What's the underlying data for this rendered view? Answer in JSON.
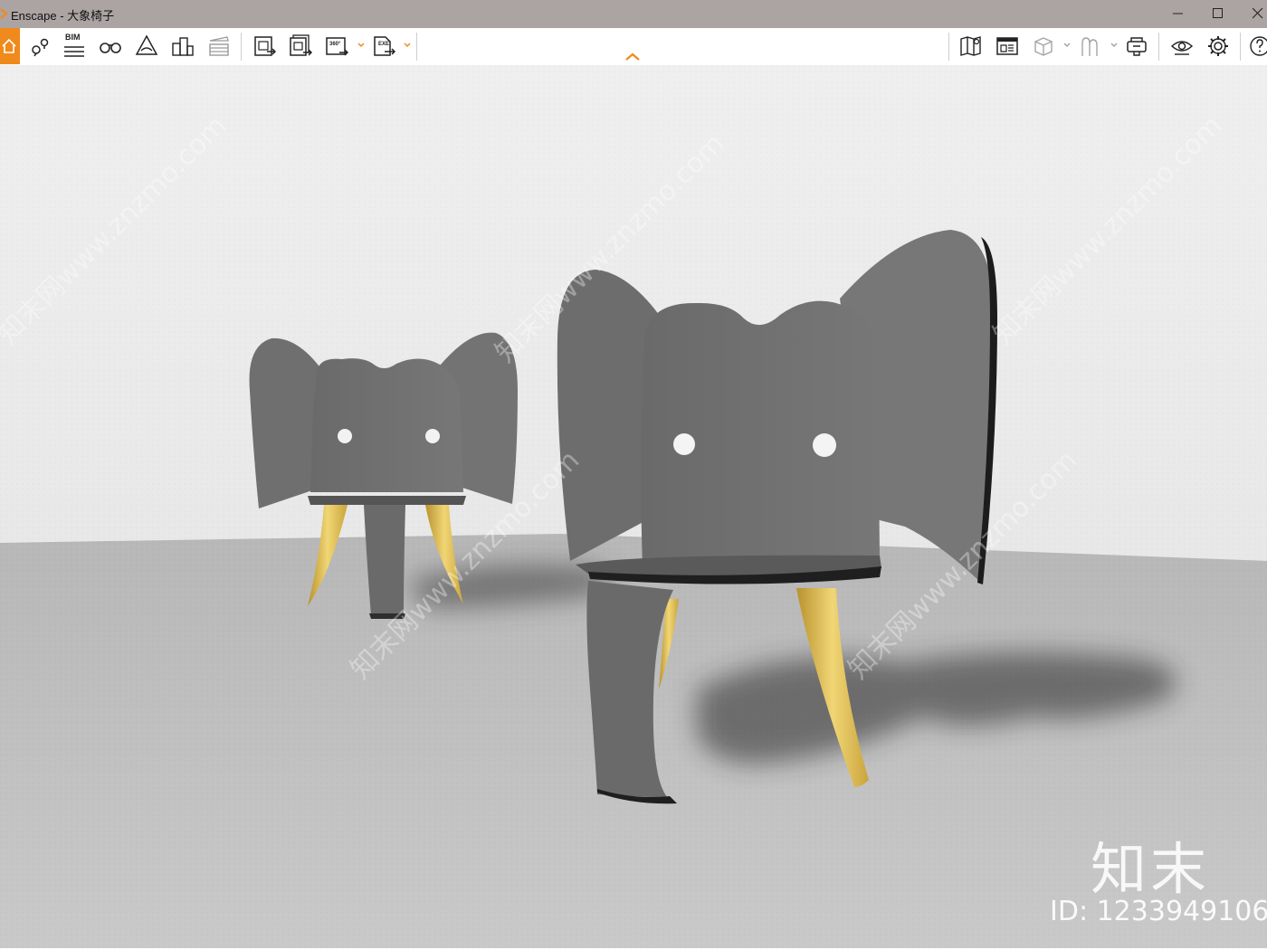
{
  "app": {
    "window_title": "Enscape - 大象椅子",
    "accent_color": "#f08a1c"
  },
  "window_controls": [
    {
      "name": "minimize",
      "icon": "minimize-icon"
    },
    {
      "name": "maximize",
      "icon": "maximize-icon"
    },
    {
      "name": "close",
      "icon": "close-icon"
    }
  ],
  "toolbar": {
    "left_tools": [
      {
        "icon": "home-icon",
        "active": true
      },
      {
        "icon": "views-icon"
      },
      {
        "icon": "bim-icon",
        "label": "BIM"
      },
      {
        "icon": "binoculars-icon"
      },
      {
        "icon": "atmosphere-icon"
      },
      {
        "icon": "asset-library-icon"
      },
      {
        "icon": "video-editor-icon"
      }
    ],
    "export_tools": [
      {
        "icon": "screenshot-export-icon"
      },
      {
        "icon": "batch-render-icon"
      },
      {
        "icon": "panorama-export-icon",
        "label": "360°"
      },
      {
        "icon": "standalone-export-icon",
        "label": "EXE"
      }
    ],
    "right_tools": [
      {
        "icon": "map-view-icon"
      },
      {
        "icon": "material-editor-icon"
      },
      {
        "icon": "cube-view-icon"
      },
      {
        "icon": "people-icon"
      },
      {
        "icon": "vr-headset-icon"
      },
      {
        "icon": "visual-settings-icon"
      },
      {
        "icon": "settings-gear-icon"
      },
      {
        "icon": "help-icon"
      }
    ],
    "collapse_icon": "chevron-up-icon"
  },
  "viewport": {
    "watermark_text": "知末网www.znzmo.com",
    "brand_mark": "知末",
    "image_id": "ID: 1233949106",
    "colors": {
      "wall": "#e6e6e6",
      "floor": "#bdbdbd",
      "chair_body": "#6e6e6e",
      "tusk": "#e6c45c"
    }
  }
}
